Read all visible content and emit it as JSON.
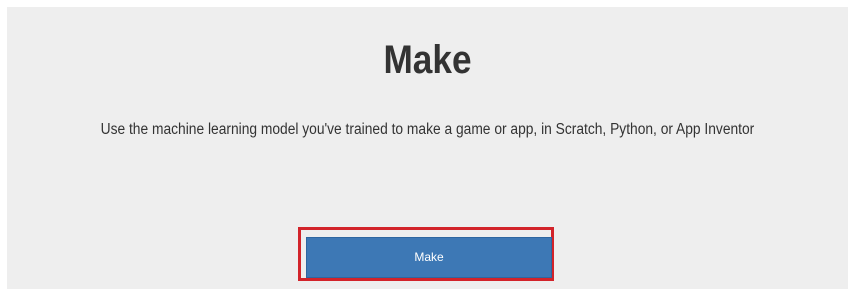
{
  "page": {
    "title": "Make",
    "description": "Use the machine learning model you've trained to make a game or app, in Scratch, Python, or App Inventor"
  },
  "actions": {
    "make_button_label": "Make"
  },
  "colors": {
    "panel_background": "#eeeeee",
    "button_background": "#3d78b5",
    "highlight_outline": "#d2232a",
    "text": "#333333"
  }
}
